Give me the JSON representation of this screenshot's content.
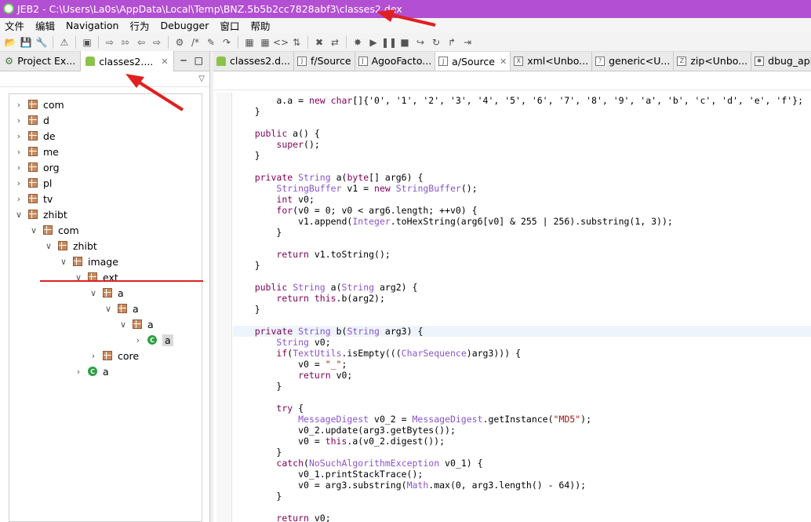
{
  "window": {
    "title": "JEB2 - C:\\Users\\La0s\\AppData\\Local\\Temp\\BNZ.5b5b2cc7828abf3\\classes2.dex"
  },
  "menu": [
    "文件",
    "编辑",
    "Navigation",
    "行为",
    "Debugger",
    "窗口",
    "帮助"
  ],
  "left_tabs": [
    {
      "label": "Project Ex...",
      "active": false
    },
    {
      "label": "classes2....",
      "active": true
    }
  ],
  "tree": [
    {
      "label": "com",
      "depth": 0,
      "toggle": ">",
      "kind": "pkg"
    },
    {
      "label": "d",
      "depth": 0,
      "toggle": ">",
      "kind": "pkg"
    },
    {
      "label": "de",
      "depth": 0,
      "toggle": ">",
      "kind": "pkg"
    },
    {
      "label": "me",
      "depth": 0,
      "toggle": ">",
      "kind": "pkg"
    },
    {
      "label": "org",
      "depth": 0,
      "toggle": ">",
      "kind": "pkg"
    },
    {
      "label": "pl",
      "depth": 0,
      "toggle": ">",
      "kind": "pkg"
    },
    {
      "label": "tv",
      "depth": 0,
      "toggle": ">",
      "kind": "pkg"
    },
    {
      "label": "zhibt",
      "depth": 0,
      "toggle": "v",
      "kind": "pkg"
    },
    {
      "label": "com",
      "depth": 1,
      "toggle": "v",
      "kind": "pkg"
    },
    {
      "label": "zhibt",
      "depth": 2,
      "toggle": "v",
      "kind": "pkg"
    },
    {
      "label": "image",
      "depth": 3,
      "toggle": "v",
      "kind": "pkg"
    },
    {
      "label": "ext",
      "depth": 4,
      "toggle": "v",
      "kind": "pkg"
    },
    {
      "label": "a",
      "depth": 5,
      "toggle": "v",
      "kind": "pkg"
    },
    {
      "label": "a",
      "depth": 6,
      "toggle": "v",
      "kind": "pkg"
    },
    {
      "label": "a",
      "depth": 7,
      "toggle": "v",
      "kind": "pkg"
    },
    {
      "label": "a",
      "depth": 8,
      "toggle": ">",
      "kind": "cls",
      "selected": true
    },
    {
      "label": "core",
      "depth": 5,
      "toggle": ">",
      "kind": "pkg"
    },
    {
      "label": "a",
      "depth": 4,
      "toggle": ">",
      "kind": "cls"
    }
  ],
  "editor_tabs": [
    {
      "label": "classes2.d...",
      "icon": "android-icon",
      "active": false
    },
    {
      "label": "f/Source",
      "icon": "source-icon",
      "active": false
    },
    {
      "label": "AgooFacto...",
      "icon": "source-icon",
      "active": false
    },
    {
      "label": "a/Source",
      "icon": "source-icon",
      "active": true
    },
    {
      "label": "xml<Unbo...",
      "icon": "xml-icon",
      "active": false
    },
    {
      "label": "generic<U...",
      "icon": "generic-icon",
      "active": false
    },
    {
      "label": "zip<Unbo...",
      "icon": "zip-icon",
      "active": false
    },
    {
      "label": "dbug_apk_",
      "icon": "debug-icon",
      "active": false
    }
  ],
  "code_lines": [
    "        a.a = new char[]{'0', '1', '2', '3', '4', '5', '6', '7', '8', '9', 'a', 'b', 'c', 'd', 'e', 'f'};",
    "    }",
    "",
    "    public a() {",
    "        super();",
    "    }",
    "",
    "    private String a(byte[] arg6) {",
    "        StringBuffer v1 = new StringBuffer();",
    "        int v0;",
    "        for(v0 = 0; v0 < arg6.length; ++v0) {",
    "            v1.append(Integer.toHexString(arg6[v0] & 255 | 256).substring(1, 3));",
    "        }",
    "",
    "        return v1.toString();",
    "    }",
    "",
    "    public String a(String arg2) {",
    "        return this.b(arg2);",
    "    }",
    "",
    "    private String b(String arg3) {",
    "        String v0;",
    "        if(TextUtils.isEmpty(((CharSequence)arg3))) {",
    "            v0 = \"_\";",
    "            return v0;",
    "        }",
    "",
    "        try {",
    "            MessageDigest v0_2 = MessageDigest.getInstance(\"MD5\");",
    "            v0_2.update(arg3.getBytes());",
    "            v0 = this.a(v0_2.digest());",
    "        }",
    "        catch(NoSuchAlgorithmException v0_1) {",
    "            v0_1.printStackTrace();",
    "            v0 = arg3.substring(Math.max(0, arg3.length() - 64));",
    "        }",
    "",
    "        return v0;"
  ],
  "highlight_line": 21,
  "colors": {
    "title_bar": "#b34fd3",
    "keyword": "#7f0055",
    "type": "#8855cc",
    "string": "#a31515",
    "annotation": "#e02020"
  }
}
